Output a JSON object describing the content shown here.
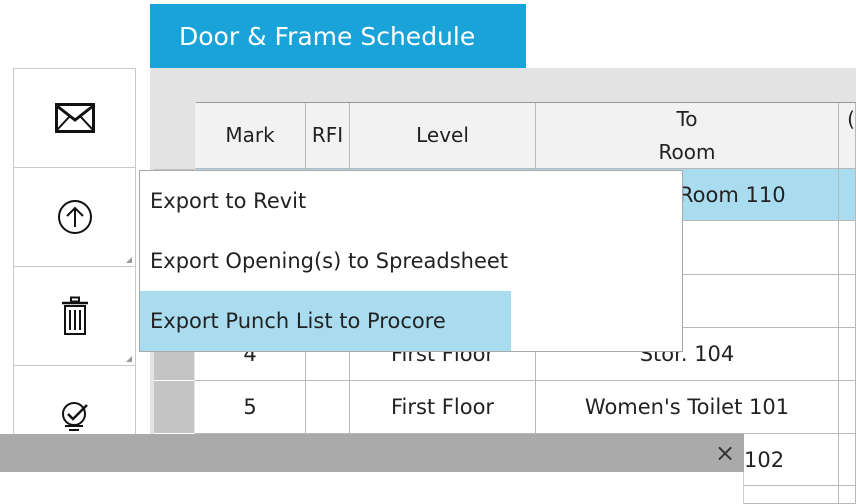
{
  "tab": {
    "title": "Door & Frame Schedule"
  },
  "table": {
    "headers": {
      "mark": "Mark",
      "rfi": "RFI",
      "level": "Level",
      "to_line1": "To",
      "to_line2": "Room",
      "next": "("
    },
    "rows": [
      {
        "mark": "",
        "level": "",
        "to_room": "Room 110"
      },
      {
        "mark": "",
        "level": "",
        "to_room": ""
      },
      {
        "mark": "",
        "level": "",
        "to_room": ""
      },
      {
        "mark": "4",
        "level": "First Floor",
        "to_room": "Stor. 104"
      },
      {
        "mark": "5",
        "level": "First Floor",
        "to_room": "Women's Toilet 101"
      },
      {
        "mark": "",
        "level": "",
        "to_room": "102"
      }
    ]
  },
  "toolbar": {
    "icons": [
      "envelope-icon",
      "upload-icon",
      "trash-icon",
      "settings-check-icon"
    ]
  },
  "menu": {
    "items": [
      {
        "label": "Export to Revit"
      },
      {
        "label": "Export Opening(s) to Spreadsheet"
      },
      {
        "label": "Export Punch List to Procore"
      }
    ]
  },
  "bar": {
    "close_symbol": "×"
  },
  "colors": {
    "accent": "#1aa3d9",
    "selection": "#aadcf0"
  }
}
